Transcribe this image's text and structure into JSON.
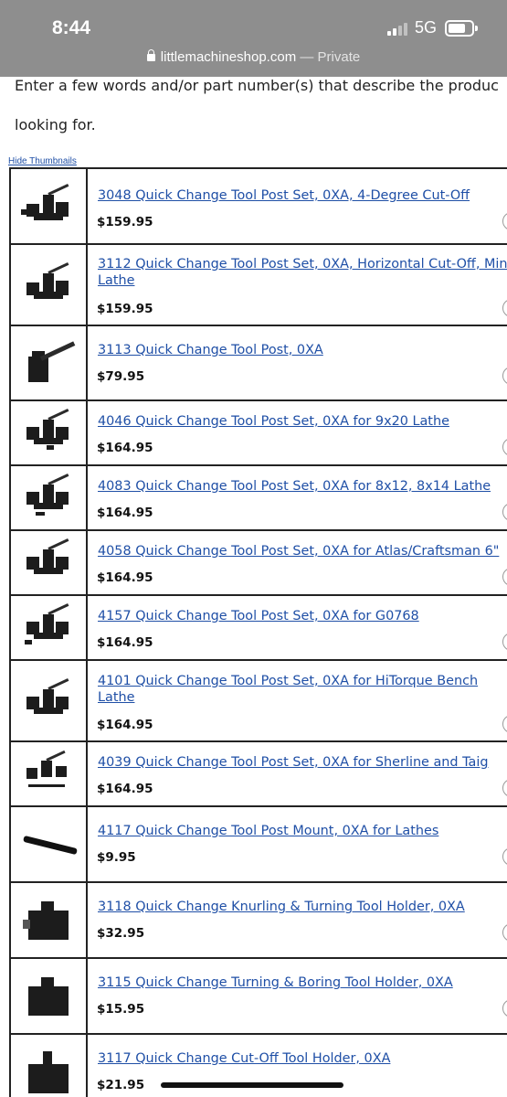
{
  "status": {
    "time": "8:44",
    "network": "5G",
    "url": "littlemachineshop.com",
    "url_private": "— Private"
  },
  "intro": {
    "line1": "Enter a few words and/or part number(s) that describe the produc",
    "line2": "looking for."
  },
  "hide_thumbnails": "Hide Thumbnails",
  "products": [
    {
      "title": "3048 Quick Change Tool Post Set, 0XA, 4-Degree Cut-Off",
      "price": "$159.95",
      "thumb": "tool-post-set-thumbnail"
    },
    {
      "title_line1": "3112 Quick Change Tool Post Set, 0XA, Horizontal Cut-Off, Min",
      "title_line2": "Lathe",
      "price": "$159.95",
      "thumb": "tool-post-set-thumbnail"
    },
    {
      "title": "3113 Quick Change Tool Post, 0XA",
      "price": "$79.95",
      "thumb": "tool-post-thumbnail"
    },
    {
      "title": "4046 Quick Change Tool Post Set, 0XA for 9x20 Lathe",
      "price": "$164.95",
      "thumb": "tool-post-set-thumbnail"
    },
    {
      "title": "4083 Quick Change Tool Post Set, 0XA for 8x12, 8x14 Lathe",
      "price": "$164.95",
      "thumb": "tool-post-set-thumbnail"
    },
    {
      "title": "4058 Quick Change Tool Post Set, 0XA for Atlas/Craftsman 6\"",
      "price": "$164.95",
      "thumb": "tool-post-set-thumbnail"
    },
    {
      "title": "4157 Quick Change Tool Post Set, 0XA for G0768",
      "price": "$164.95",
      "thumb": "tool-post-set-thumbnail"
    },
    {
      "title_line1": "4101 Quick Change Tool Post Set, 0XA for HiTorque Bench",
      "title_line2": "Lathe",
      "price": "$164.95",
      "thumb": "tool-post-set-thumbnail"
    },
    {
      "title": "4039 Quick Change Tool Post Set, 0XA for Sherline and Taig",
      "price": "$164.95",
      "thumb": "tool-post-set-thumbnail"
    },
    {
      "title": "4117 Quick Change Tool Post Mount, 0XA for Lathes",
      "price": "$9.95",
      "thumb": "post-mount-thumbnail"
    },
    {
      "title": "3118 Quick Change Knurling & Turning Tool Holder, 0XA",
      "price": "$32.95",
      "thumb": "tool-holder-thumbnail"
    },
    {
      "title": "3115 Quick Change Turning & Boring Tool Holder, 0XA",
      "price": "$15.95",
      "thumb": "tool-holder-thumbnail"
    },
    {
      "title": "3117 Quick Change Cut-Off Tool Holder, 0XA",
      "price": "$21.95",
      "thumb": "tool-holder-thumbnail"
    }
  ],
  "colors": {
    "link": "#1f4fa6",
    "statusbar": "#8e8e8e",
    "border": "#222222"
  }
}
